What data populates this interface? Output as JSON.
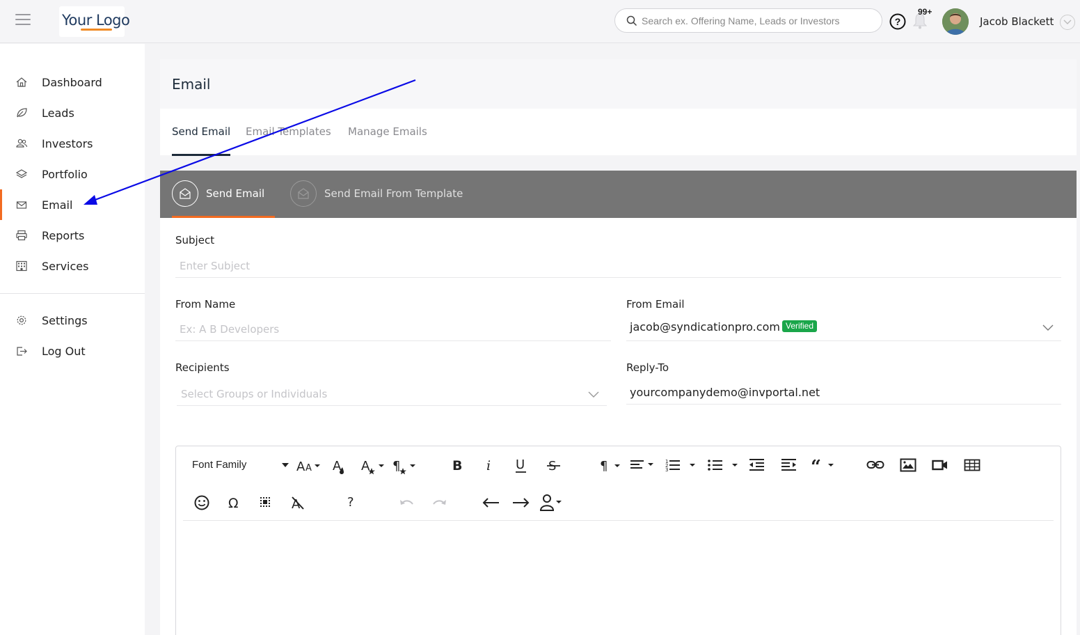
{
  "header": {
    "logo_text": "Your Logo",
    "search_placeholder": "Search ex. Offering Name, Leads or Investors",
    "notification_count": "99+",
    "user_name": "Jacob Blackett"
  },
  "sidebar": {
    "items": [
      {
        "label": "Dashboard",
        "icon": "home-icon"
      },
      {
        "label": "Leads",
        "icon": "leaf-icon"
      },
      {
        "label": "Investors",
        "icon": "users-icon"
      },
      {
        "label": "Portfolio",
        "icon": "layers-icon"
      },
      {
        "label": "Email",
        "icon": "mail-icon",
        "active": true
      },
      {
        "label": "Reports",
        "icon": "printer-icon"
      },
      {
        "label": "Services",
        "icon": "building-icon"
      },
      {
        "label": "Settings",
        "icon": "gear-icon"
      },
      {
        "label": "Log Out",
        "icon": "logout-icon"
      }
    ]
  },
  "page": {
    "title": "Email",
    "tabs": [
      "Send Email",
      "Email Templates",
      "Manage Emails"
    ],
    "subtabs": [
      "Send Email",
      "Send Email From Template"
    ]
  },
  "form": {
    "subject_label": "Subject",
    "subject_placeholder": "Enter Subject",
    "from_name_label": "From Name",
    "from_name_placeholder": "Ex: A B Developers",
    "from_email_label": "From Email",
    "from_email_value": "jacob@syndicationpro.com",
    "verified_badge": "Verified",
    "recipients_label": "Recipients",
    "recipients_placeholder": "Select Groups or Individuals",
    "reply_to_label": "Reply-To",
    "reply_to_value": "yourcompanydemo@invportal.net"
  },
  "editor": {
    "font_family_label": "Font Family",
    "help_symbol": "?"
  },
  "colors": {
    "accent": "#f26b21",
    "subtab_bar": "#757575",
    "verified": "#1aa64a",
    "annotation_arrow": "#0a0ae6"
  }
}
